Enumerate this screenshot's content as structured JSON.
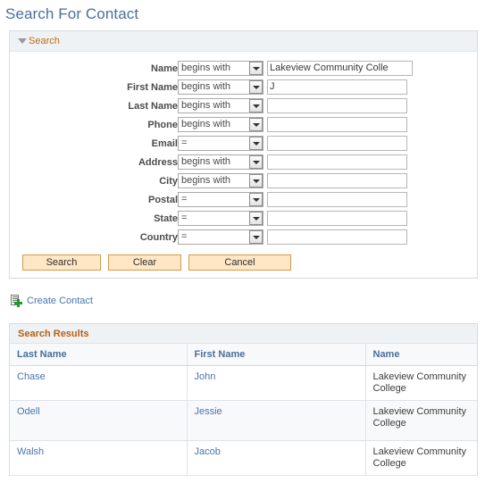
{
  "page": {
    "title": "Search For Contact"
  },
  "search_panel": {
    "header_label": "Search",
    "collapse_icon": "triangle-down-icon",
    "criteria": [
      {
        "label": "Name",
        "operator": "begins with",
        "value": "Lakeview Community Colle",
        "placeholder": ""
      },
      {
        "label": "First Name",
        "operator": "begins with",
        "value": "J",
        "placeholder": ""
      },
      {
        "label": "Last Name",
        "operator": "begins with",
        "value": "",
        "placeholder": ""
      },
      {
        "label": "Phone",
        "operator": "begins with",
        "value": "",
        "placeholder": ""
      },
      {
        "label": "Email",
        "operator": "=",
        "value": "",
        "placeholder": ""
      },
      {
        "label": "Address",
        "operator": "begins with",
        "value": "",
        "placeholder": ""
      },
      {
        "label": "City",
        "operator": "begins with",
        "value": "",
        "placeholder": ""
      },
      {
        "label": "Postal",
        "operator": "=",
        "value": "",
        "placeholder": ""
      },
      {
        "label": "State",
        "operator": "=",
        "value": "",
        "placeholder": ""
      },
      {
        "label": "Country",
        "operator": "=",
        "value": "",
        "placeholder": ""
      }
    ],
    "buttons": {
      "search": "Search",
      "clear": "Clear",
      "cancel": "Cancel"
    }
  },
  "create_contact": {
    "label": "Create Contact",
    "icon": "document-add-icon"
  },
  "results": {
    "header_label": "Search Results",
    "columns": [
      "Last Name",
      "First Name",
      "Name"
    ],
    "rows": [
      {
        "last_name": "Chase",
        "first_name": "John",
        "name": "Lakeview Community College"
      },
      {
        "last_name": "Odell",
        "first_name": "Jessie",
        "name": "Lakeview Community College"
      },
      {
        "last_name": "Walsh",
        "first_name": "Jacob",
        "name": "Lakeview Community College"
      }
    ]
  },
  "colors": {
    "title": "#4a6f9e",
    "panel_header_bg": "#eff2f4",
    "section_label": "#c06a14",
    "results_label": "#b65f10",
    "link": "#4a74ad",
    "button_bg": "#ffe6c4",
    "button_border": "#d39b4e"
  }
}
